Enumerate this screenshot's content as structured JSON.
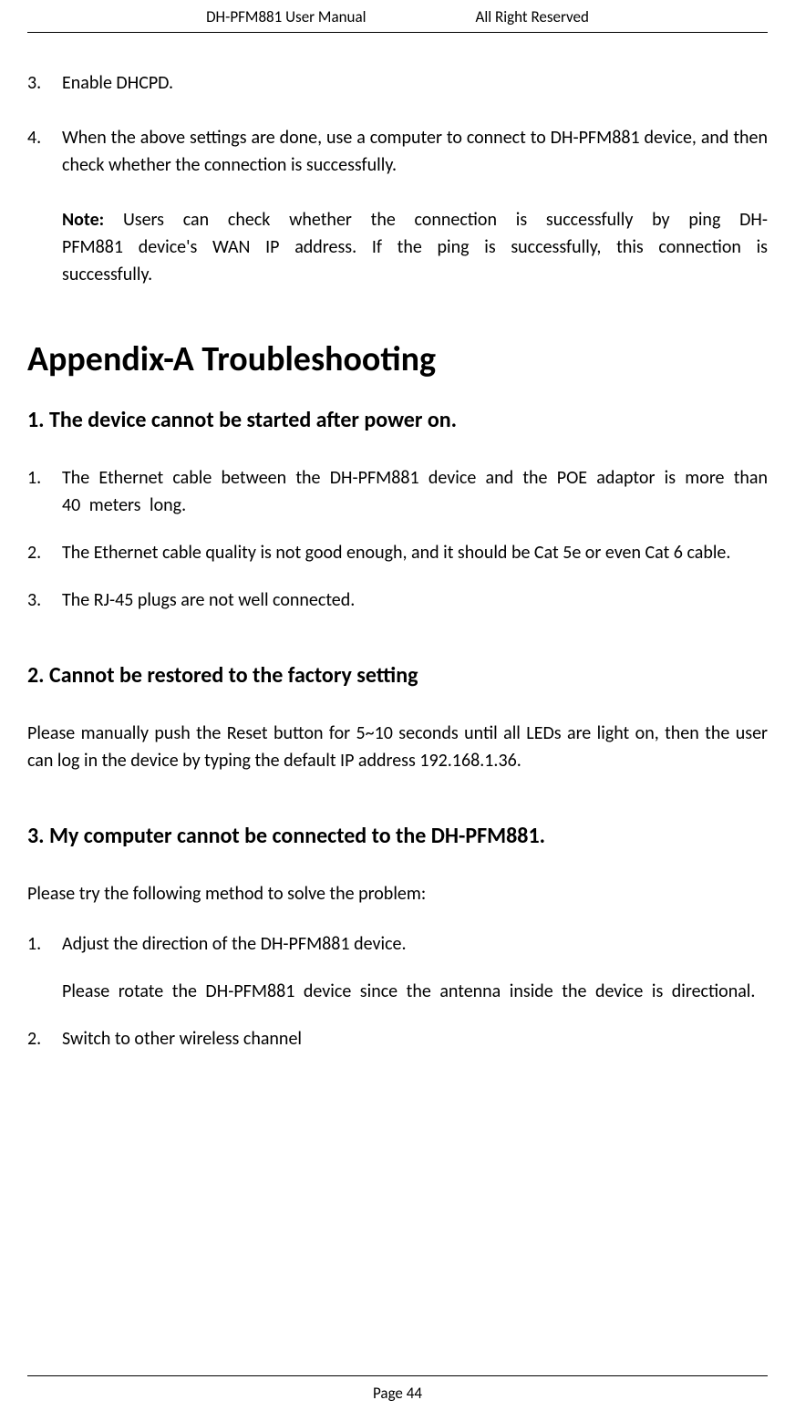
{
  "header": {
    "left": "DH-PFM881 User Manual",
    "right": "All Right Reserved"
  },
  "intro_items": {
    "num3": "3.",
    "text3": "Enable DHCPD.",
    "num4": "4.",
    "text4": "When the above settings are done, use a computer to connect to DH-PFM881 device, and then check whether the connection is successfully."
  },
  "note": {
    "label": "Note:",
    "text": " Users can check whether the connection is successfully by ping DH-PFM881 device's WAN IP address. If the ping is successfully, this connection is successfully."
  },
  "appendix_title": "Appendix-A Troubleshooting",
  "section1": {
    "heading": "1. The device cannot be started after power on.",
    "item1_num": "1.",
    "item1_text": "The Ethernet cable between the DH-PFM881 device and the POE adaptor is more than 40 meters long.",
    "item2_num": "2.",
    "item2_text": "The Ethernet cable quality is not good enough, and it should be Cat 5e or even Cat 6 cable.",
    "item3_num": "3.",
    "item3_text": "The RJ-45 plugs are not well connected."
  },
  "section2": {
    "heading": "2. Cannot be restored to the factory setting",
    "text": "Please manually push the Reset button for 5~10 seconds until all LEDs are light on, then the user can log in the device by typing the default IP address 192.168.1.36."
  },
  "section3": {
    "heading": "3. My computer cannot be connected to the DH-PFM881.",
    "intro": "Please try the following method to solve the problem:",
    "item1_num": "1.",
    "item1_text": "Adjust the direction of the DH-PFM881 device.",
    "item1_note": "Please rotate the DH-PFM881 device since the antenna inside the device is directional.",
    "item2_num": "2.",
    "item2_text": "Switch to other wireless channel"
  },
  "footer": "Page 44"
}
